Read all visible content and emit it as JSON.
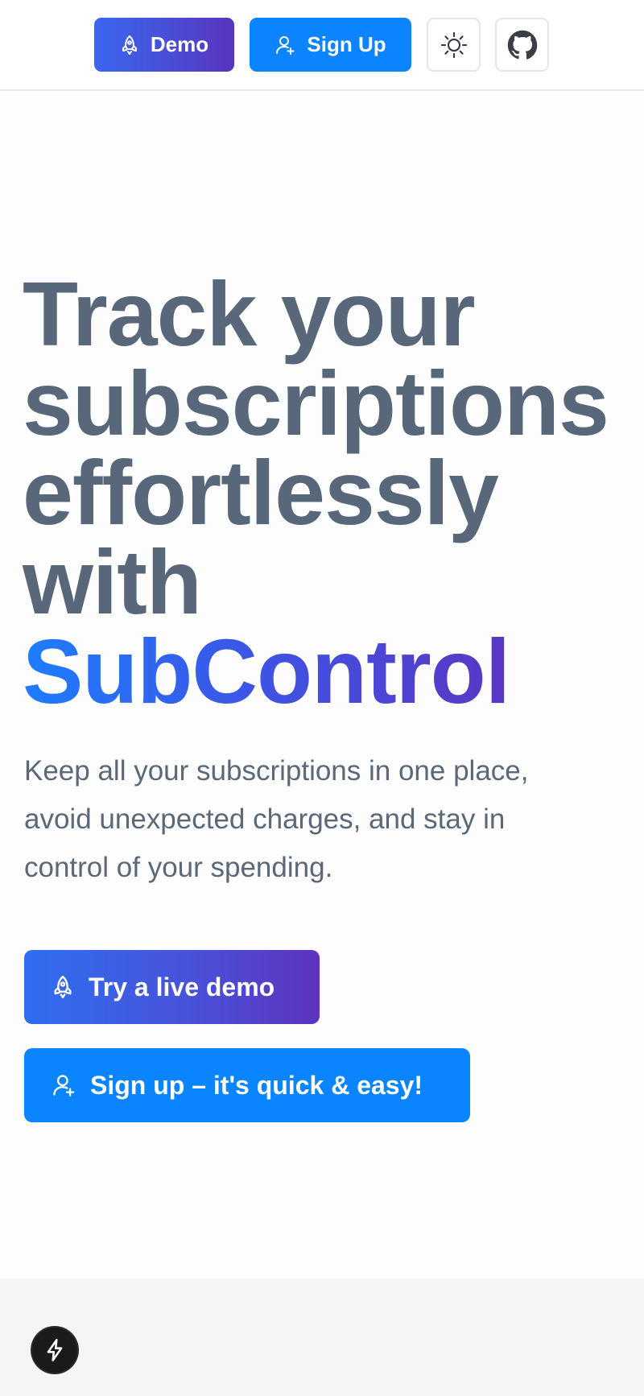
{
  "header": {
    "demo_label": "Demo",
    "signup_label": "Sign Up",
    "theme_icon": "sun-icon",
    "github_icon": "github-icon"
  },
  "hero": {
    "title_line1": "Track your",
    "title_line2": "subscriptions",
    "title_line3": "effortlessly",
    "title_line4": "with",
    "brand": "SubControl",
    "subtitle": "Keep all your subscriptions in one place, avoid unexpected charges, and stay in control of your spending."
  },
  "cta": {
    "demo_label": "Try a live demo",
    "signup_label": "Sign up – it's quick & easy!"
  },
  "icons": {
    "demo": "rocket-icon",
    "signup": "user-plus-icon",
    "fab": "lightning-icon"
  },
  "colors": {
    "primary_blue": "#0a84ff",
    "gradient_start": "#3b66f0",
    "gradient_end": "#5a34bd",
    "title_gray": "#586779"
  }
}
